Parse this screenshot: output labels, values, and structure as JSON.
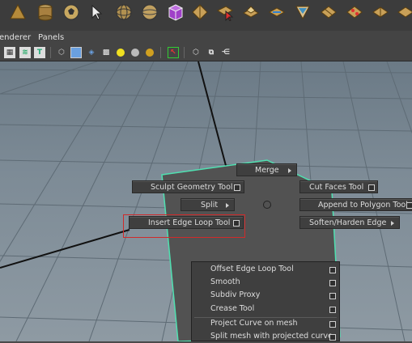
{
  "menubar": {
    "items": [
      "enderer",
      "Panels"
    ]
  },
  "shelf": {
    "icons": [
      "pyramid-icon",
      "cylinder-icon",
      "soccer-ball-icon",
      "sphere-icon",
      "sphere-wire-icon",
      "cube-purple-icon",
      "plane-icon",
      "cursor-plane-icon",
      "extrude-icon",
      "bevel-icon",
      "bridge-icon",
      "split-icon",
      "combine-icon",
      "separate-icon"
    ]
  },
  "toolbar": {
    "icons": [
      "grid-icon",
      "texture-icon",
      "text-icon",
      "wireframe-cube-icon",
      "smooth-shade-cube-icon",
      "textured-cube-icon",
      "checker-icon",
      "light-yellow-icon",
      "shadow-sphere-icon",
      "gold-sphere-icon",
      "isolate-select-icon",
      "xray-icon",
      "xray-joints-icon",
      "share-icon"
    ]
  },
  "marking_menu": {
    "merge": "Merge",
    "sculpt": "Sculpt Geometry Tool",
    "cut_faces": "Cut Faces Tool",
    "split": "Split",
    "append": "Append to Polygon Tool",
    "insert_edge_loop": "Insert Edge Loop Tool",
    "soften_harden": "Soften/Harden Edge"
  },
  "submenu": {
    "items": [
      "Offset Edge Loop Tool",
      "Smooth",
      "Subdiv Proxy",
      "Crease Tool",
      "Project Curve on mesh",
      "Split mesh with projected curve"
    ]
  },
  "colors": {
    "highlight": "#d02a2a",
    "mesh_edge": "#4fe0b0"
  }
}
